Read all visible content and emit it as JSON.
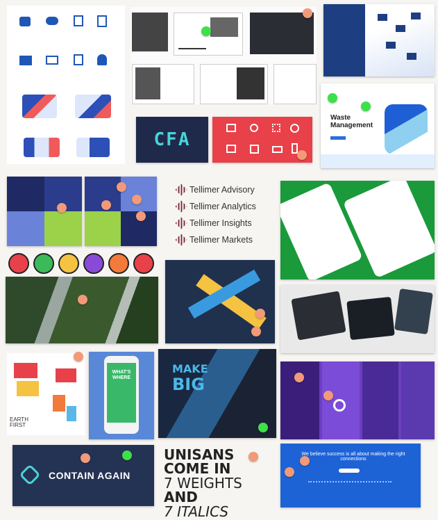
{
  "tellimer": {
    "items": [
      {
        "label": "Tellimer Advisory"
      },
      {
        "label": "Tellimer Analytics"
      },
      {
        "label": "Tellimer Insights"
      },
      {
        "label": "Tellimer Markets"
      }
    ]
  },
  "waste": {
    "title_line1": "Waste",
    "title_line2": "Management"
  },
  "cfa": {
    "logo": "CFA"
  },
  "whats_where": {
    "line1": "WHAT'S",
    "line2": "WHERE"
  },
  "earth_first": {
    "line1": "EARTH",
    "line2": "FIRST"
  },
  "make_big": {
    "line1": "MAKE",
    "line2": "BIG"
  },
  "contain": {
    "label": "CONTAIN AGAIN"
  },
  "unisans": {
    "line1": "UNISANS",
    "line2": "COME IN",
    "line3": "7 WEIGHTS",
    "line4": "AND",
    "line5": "7 ITALICS"
  },
  "connections": {
    "text": "We believe success is all about making the right connections"
  },
  "colors": {
    "navy": "#1f2a4a",
    "red": "#e8414a",
    "teal": "#2bb3b8",
    "green": "#1a9a3a",
    "purple": "#5b2fa6",
    "blue": "#1a5fd0"
  }
}
